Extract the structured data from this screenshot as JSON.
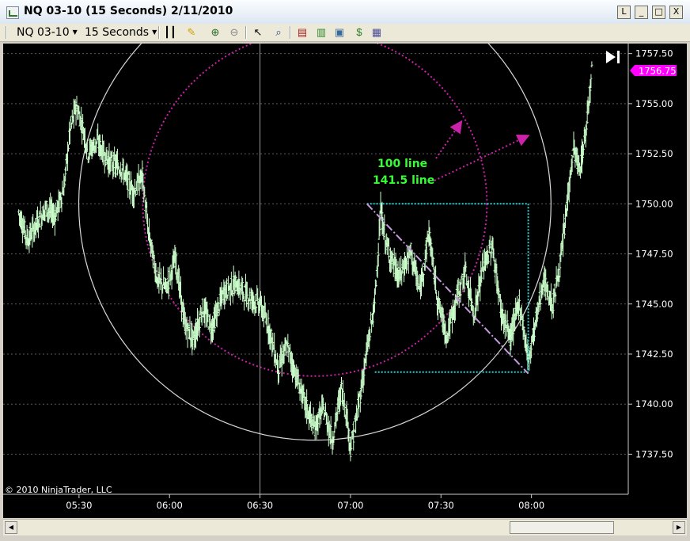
{
  "window": {
    "title": "NQ 03-10 (15 Seconds)  2/11/2010",
    "controls": {
      "link": "L",
      "minimize": "_",
      "maximize": "□",
      "close": "X"
    }
  },
  "toolbar": {
    "instrument": "NQ 03-10",
    "interval": "15 Seconds",
    "icons": [
      "bar-type-icon",
      "drawing-pencil-icon",
      "zoom-in-icon",
      "zoom-out-icon",
      "pointer-icon",
      "search-icon",
      "indicators-icon",
      "strategies-icon",
      "chart-properties-icon",
      "dollar-icon",
      "template-icon"
    ]
  },
  "chart": {
    "copyright": "© 2010 NinjaTrader, LLC",
    "last_price": "1756.75",
    "colors": {
      "background": "#000000",
      "bars": "#ccffcc",
      "grid": "#5a5a5a",
      "annotation": "#cc22aa",
      "label": "#33ff33",
      "accent": "#ff00ff",
      "box": "#33cccc"
    },
    "annotations": {
      "line1": "100 line",
      "line2": "141.5 line"
    }
  },
  "chart_data": {
    "type": "bar",
    "title": "NQ 03-10 (15 Seconds)",
    "x_ticks": [
      "05:30",
      "06:00",
      "06:30",
      "07:00",
      "07:30",
      "08:00"
    ],
    "y_ticks": [
      "1757.50",
      "1755.00",
      "1752.50",
      "1750.00",
      "1747.50",
      "1745.00",
      "1742.50",
      "1740.00",
      "1737.50"
    ],
    "ylim": [
      1735.5,
      1758
    ],
    "grid": true,
    "path": [
      [
        "05:10",
        1749.6
      ],
      [
        "05:13",
        1748.2
      ],
      [
        "05:16",
        1749.0
      ],
      [
        "05:19",
        1749.8
      ],
      [
        "05:22",
        1749.4
      ],
      [
        "05:25",
        1750.8
      ],
      [
        "05:27",
        1753.6
      ],
      [
        "05:29",
        1754.9
      ],
      [
        "05:31",
        1754.0
      ],
      [
        "05:33",
        1752.6
      ],
      [
        "05:36",
        1753.1
      ],
      [
        "05:40",
        1752.1
      ],
      [
        "05:44",
        1751.8
      ],
      [
        "05:48",
        1750.6
      ],
      [
        "05:51",
        1751.4
      ],
      [
        "05:53",
        1748.6
      ],
      [
        "05:56",
        1746.2
      ],
      [
        "05:59",
        1745.8
      ],
      [
        "06:02",
        1747.3
      ],
      [
        "06:05",
        1744.0
      ],
      [
        "06:08",
        1743.2
      ],
      [
        "06:11",
        1744.8
      ],
      [
        "06:14",
        1743.8
      ],
      [
        "06:18",
        1745.6
      ],
      [
        "06:22",
        1746.0
      ],
      [
        "06:26",
        1745.4
      ],
      [
        "06:30",
        1745.0
      ],
      [
        "06:33",
        1743.8
      ],
      [
        "06:36",
        1741.8
      ],
      [
        "06:39",
        1742.9
      ],
      [
        "06:42",
        1741.4
      ],
      [
        "06:45",
        1740.0
      ],
      [
        "06:48",
        1738.8
      ],
      [
        "06:51",
        1739.8
      ],
      [
        "06:54",
        1738.2
      ],
      [
        "06:57",
        1740.8
      ],
      [
        "06:59",
        1739.2
      ],
      [
        "07:00",
        1737.8
      ],
      [
        "07:02",
        1739.3
      ],
      [
        "07:05",
        1742.2
      ],
      [
        "07:08",
        1745.0
      ],
      [
        "07:10",
        1749.6
      ],
      [
        "07:12",
        1747.9
      ],
      [
        "07:16",
        1746.3
      ],
      [
        "07:20",
        1747.6
      ],
      [
        "07:23",
        1745.6
      ],
      [
        "07:26",
        1748.6
      ],
      [
        "07:29",
        1745.1
      ],
      [
        "07:32",
        1743.4
      ],
      [
        "07:35",
        1745.2
      ],
      [
        "07:38",
        1746.6
      ],
      [
        "07:41",
        1744.5
      ],
      [
        "07:44",
        1746.9
      ],
      [
        "07:47",
        1747.9
      ],
      [
        "07:50",
        1744.6
      ],
      [
        "07:53",
        1743.3
      ],
      [
        "07:56",
        1745.1
      ],
      [
        "07:59",
        1742.2
      ],
      [
        "08:01",
        1743.8
      ],
      [
        "08:04",
        1746.2
      ],
      [
        "08:07",
        1744.9
      ],
      [
        "08:10",
        1747.4
      ],
      [
        "08:12",
        1750.3
      ],
      [
        "08:14",
        1752.8
      ],
      [
        "08:16",
        1751.6
      ],
      [
        "08:18",
        1753.6
      ],
      [
        "08:20",
        1756.75
      ]
    ],
    "circles": [
      {
        "name": "100 line",
        "center": [
          "07:00",
          1750.0
        ],
        "radius_y": 8.6
      },
      {
        "name": "141.5 line",
        "center": [
          "07:00",
          1750.0
        ],
        "radius_y": 11.8
      }
    ],
    "retracement_box": {
      "x": [
        "07:12",
        "08:00"
      ],
      "y": [
        1741.6,
        1750.0
      ]
    }
  }
}
